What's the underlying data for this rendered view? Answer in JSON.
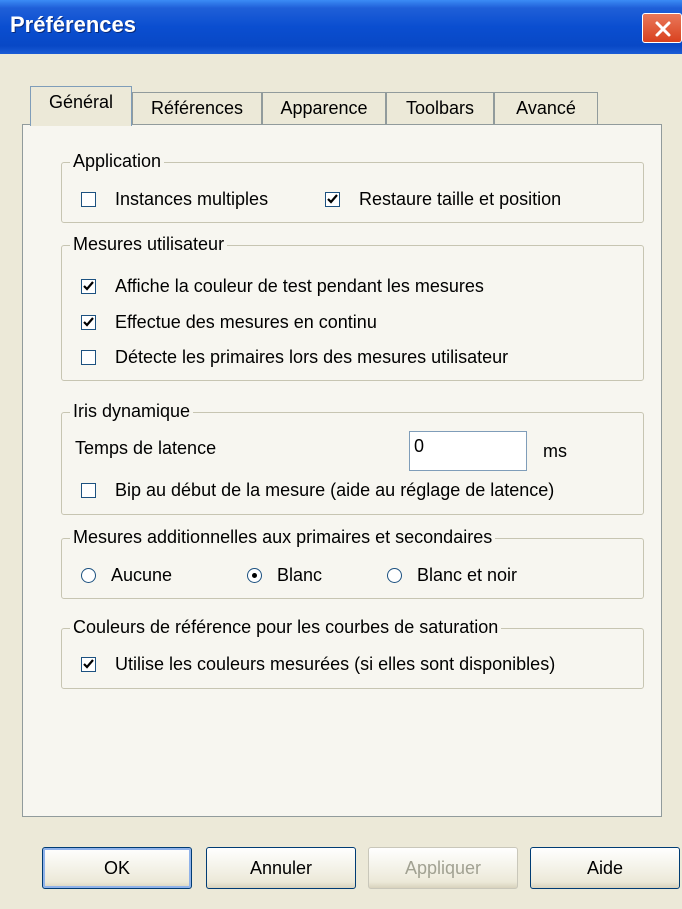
{
  "window": {
    "title": "Préférences"
  },
  "tabs": [
    {
      "label": "Général"
    },
    {
      "label": "Références"
    },
    {
      "label": "Apparence"
    },
    {
      "label": "Toolbars"
    },
    {
      "label": "Avancé"
    }
  ],
  "groups": {
    "application": {
      "title": "Application",
      "items": [
        {
          "label": "Instances multiples",
          "checked": false
        },
        {
          "label": "Restaure taille et position",
          "checked": true
        }
      ]
    },
    "mesures_utilisateur": {
      "title": "Mesures utilisateur",
      "items": [
        {
          "label": "Affiche la couleur de test pendant les mesures",
          "checked": true
        },
        {
          "label": "Effectue des mesures en continu",
          "checked": true
        },
        {
          "label": "Détecte les primaires lors des mesures utilisateur",
          "checked": false
        }
      ]
    },
    "iris": {
      "title": "Iris dynamique",
      "latency_label": "Temps de latence",
      "latency_value": "0",
      "latency_unit": "ms",
      "bip": {
        "label": "Bip au début de la mesure (aide au réglage de latence)",
        "checked": false
      }
    },
    "mesures_add": {
      "title": "Mesures additionnelles aux primaires et secondaires",
      "options": [
        {
          "label": "Aucune",
          "selected": false
        },
        {
          "label": "Blanc",
          "selected": true
        },
        {
          "label": "Blanc et noir",
          "selected": false
        }
      ]
    },
    "couleurs_ref": {
      "title": "Couleurs de référence pour les courbes de saturation",
      "item": {
        "label": "Utilise les couleurs mesurées (si elles sont disponibles)",
        "checked": true
      }
    }
  },
  "buttons": {
    "ok": "OK",
    "annuler": "Annuler",
    "appliquer": "Appliquer",
    "aide": "Aide"
  }
}
